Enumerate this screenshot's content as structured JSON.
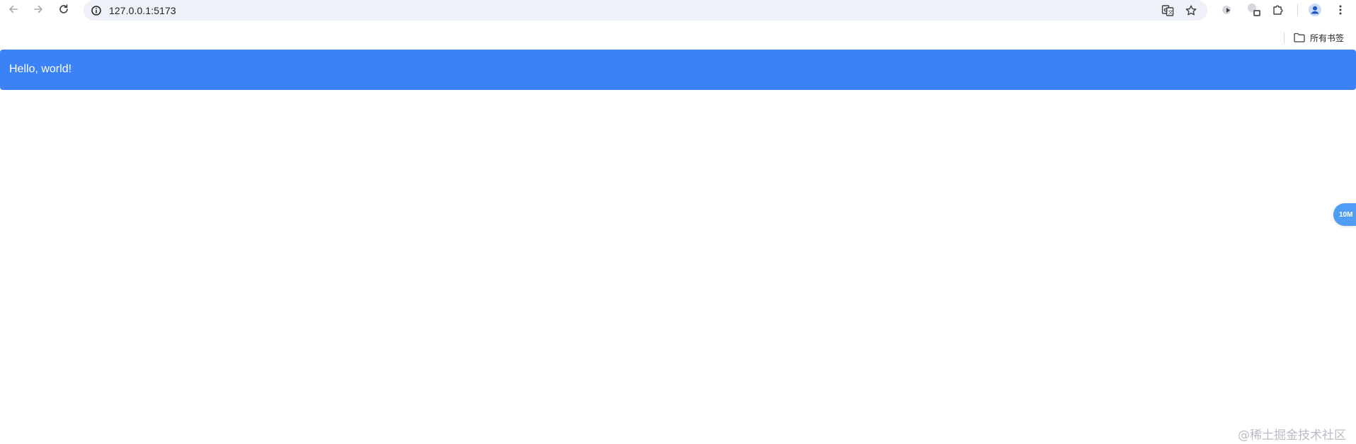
{
  "browser": {
    "url": "127.0.0.1:5173",
    "icons": {
      "back": "arrow-left-icon",
      "forward": "arrow-right-icon",
      "reload": "reload-icon",
      "site_info": "info-icon",
      "translate": "translate-icon",
      "bookmark_star": "star-icon",
      "extension_1": "media-extension-icon",
      "extension_2": "globe-extension-icon",
      "extensions": "puzzle-icon",
      "profile": "profile-icon",
      "menu": "kebab-menu-icon"
    }
  },
  "bookmarks_bar": {
    "all_bookmarks_label": "所有书签"
  },
  "page": {
    "banner_text": "Hello, world!",
    "banner_color": "#3b82f6",
    "float_badge_label": "10M"
  },
  "watermark": "@稀土掘金技术社区"
}
